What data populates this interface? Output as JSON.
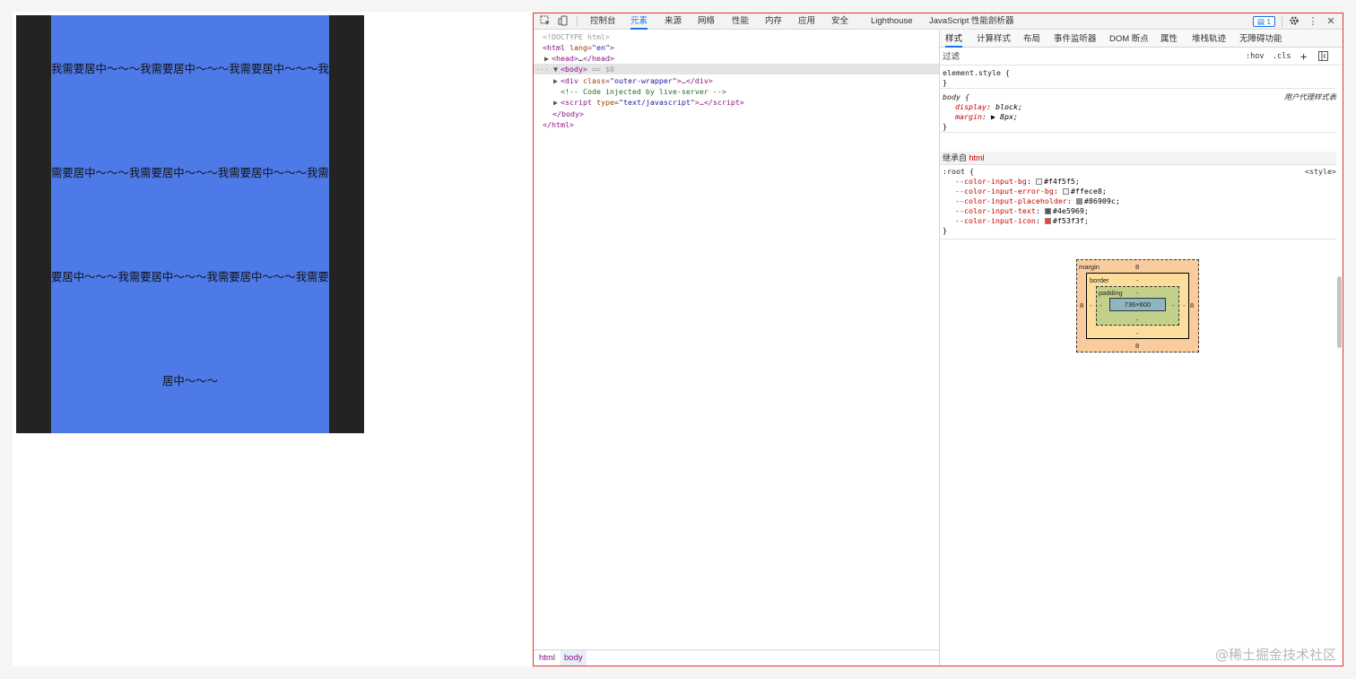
{
  "preview": {
    "lines": [
      "我需要居中～～～我需要居中～～～我需要居中～～～我需要居中～～～",
      "需要居中～～～我需要居中～～～我需要居中～～～我需要居中～～～",
      "要居中～～～我需要居中～～～我需要居中～～～我需要居中～～～",
      "居中～～～"
    ]
  },
  "devtools": {
    "toolbar": {
      "tabs": [
        "控制台",
        "元素",
        "来源",
        "网络",
        "性能",
        "内存",
        "应用",
        "安全",
        "Lighthouse",
        "JavaScript 性能剖析器"
      ],
      "issues_count": "1"
    },
    "dom": {
      "doctype": "<!DOCTYPE html>",
      "html_open_tag": "html",
      "html_lang_attr": "lang",
      "html_lang_val": "\"en\"",
      "head": "head",
      "head_ellipsis": "…",
      "body_tag": "body",
      "body_suffix": " == $0",
      "div_tag": "div",
      "div_attr": "class",
      "div_val": "\"outer-wrapper\"",
      "comment": "<!-- Code injected by live-server -->",
      "script_tag": "script",
      "script_attr": "type",
      "script_val": "\"text/javascript\"",
      "body_close": "</body>",
      "html_close": "</html>"
    },
    "breadcrumbs": [
      "html",
      "body"
    ],
    "styles": {
      "sub_tabs": [
        "样式",
        "计算样式",
        "布局",
        "事件监听器",
        "DOM 断点",
        "属性",
        "堆栈轨迹",
        "无障碍功能"
      ],
      "filter_placeholder": "过滤",
      "hov": ":hov",
      "cls": ".cls",
      "element_style": "element.style {",
      "close_brace": "}",
      "body_selector": "body {",
      "ua_origin": "用户代理样式表",
      "body_props": [
        {
          "name": "display",
          "value": "block;"
        },
        {
          "name": "margin",
          "value": "8px;"
        }
      ],
      "inherited_label": "继承自",
      "inherited_from": "html",
      "root_selector": ":root {",
      "root_origin": "<style>",
      "root_props": [
        {
          "name": "--color-input-bg",
          "value": "#f4f5f5;",
          "color": "#f4f5f5"
        },
        {
          "name": "--color-input-error-bg",
          "value": "#ffece8;",
          "color": "#ffece8"
        },
        {
          "name": "--color-input-placeholder",
          "value": "#86909c;",
          "color": "#86909c"
        },
        {
          "name": "--color-input-text",
          "value": "#4e5969;",
          "color": "#4e5969"
        },
        {
          "name": "--color-input-icon",
          "value": "#f53f3f;",
          "color": "#f53f3f"
        }
      ]
    },
    "box_model": {
      "margin_label": "margin",
      "margin_top": "8",
      "margin_bottom": "8",
      "margin_left": "8",
      "margin_right": "8",
      "border_label": "border",
      "border_top": "-",
      "border_bottom": "-",
      "border_left": "-",
      "border_right": "-",
      "padding_label": "padding",
      "padding_top": "-",
      "padding_bottom": "-",
      "padding_left": "-",
      "padding_right": "-",
      "content": "736×600"
    }
  },
  "watermark": "@稀土掘金技术社区"
}
